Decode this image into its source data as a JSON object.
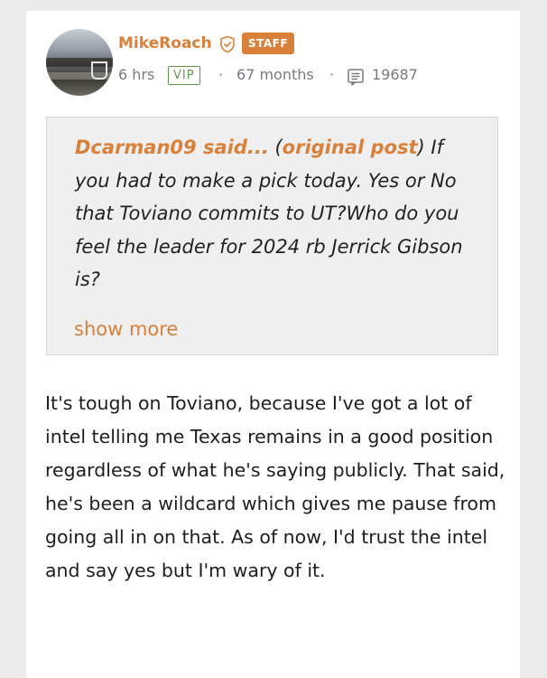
{
  "post": {
    "username": "MikeRoach",
    "badge": "STAFF",
    "time_ago": "6 hrs",
    "vip_label": "VIP",
    "separator": "·",
    "member_duration": "67 months",
    "post_count": "19687",
    "accent_color": "#d9803a",
    "vip_color": "#5f9a4c"
  },
  "quote": {
    "author": "Dcarman09",
    "said": " said...",
    "open_paren": " (",
    "link_text": "original post",
    "close_paren": ")",
    "text": " If you had to make a pick today. Yes or No that Toviano commits to UT?Who do you feel the leader for 2024 rb Jerrick Gibson is?",
    "show_more": "show more"
  },
  "body": {
    "text": "It's tough on Toviano, because I've got a lot of intel telling me Texas remains in a good position regardless of what he's saying publicly. That said, he's been a wildcard which gives me pause from going all in on that. As of now, I'd trust the intel and say yes but I'm wary of it."
  },
  "icons": [
    "avatar",
    "shield-check-icon",
    "posts-icon"
  ]
}
